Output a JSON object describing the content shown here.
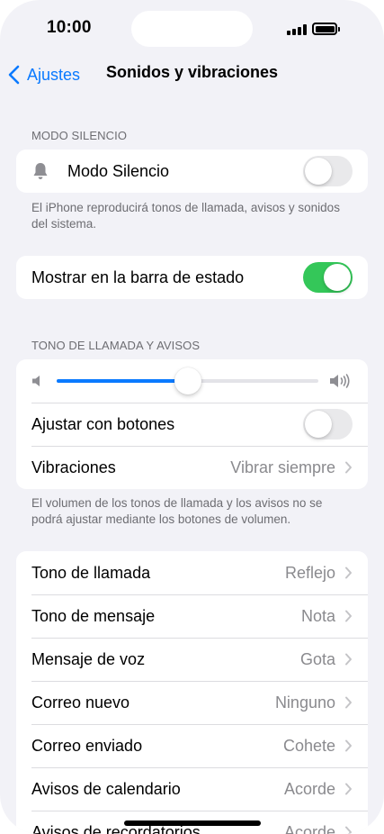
{
  "status_bar": {
    "time": "10:00",
    "battery_level": 1.0,
    "signal_bars": 4
  },
  "nav": {
    "back_label": "Ajustes",
    "title": "Sonidos y vibraciones"
  },
  "silent_mode": {
    "header": "MODO SILENCIO",
    "label": "Modo Silencio",
    "icon": "bell-icon",
    "enabled": false,
    "footer": "El iPhone reproducirá tonos de llamada, avisos y sonidos del sistema."
  },
  "status_bar_toggle": {
    "label": "Mostrar en la barra de estado",
    "enabled": true
  },
  "ringtone_alerts": {
    "header": "TONO DE LLAMADA Y AVISOS",
    "volume_level": 0.5,
    "volume_low_icon": "speaker-low-icon",
    "volume_high_icon": "speaker-high-icon",
    "adjust_label": "Ajustar con botones",
    "adjust_enabled": false,
    "vibration_label": "Vibraciones",
    "vibration_value": "Vibrar siempre",
    "footer": "El volumen de los tonos de llamada y los avisos no se podrá ajustar mediante los botones de volumen."
  },
  "sounds": [
    {
      "label": "Tono de llamada",
      "value": "Reflejo"
    },
    {
      "label": "Tono de mensaje",
      "value": "Nota"
    },
    {
      "label": "Mensaje de voz",
      "value": "Gota"
    },
    {
      "label": "Correo nuevo",
      "value": "Ninguno"
    },
    {
      "label": "Correo enviado",
      "value": "Cohete"
    },
    {
      "label": "Avisos de calendario",
      "value": "Acorde"
    },
    {
      "label": "Avisos de recordatorios",
      "value": "Acorde"
    }
  ],
  "colors": {
    "accent": "#0a7aff",
    "toggle_on": "#34c759",
    "background": "#f2f2f7"
  }
}
